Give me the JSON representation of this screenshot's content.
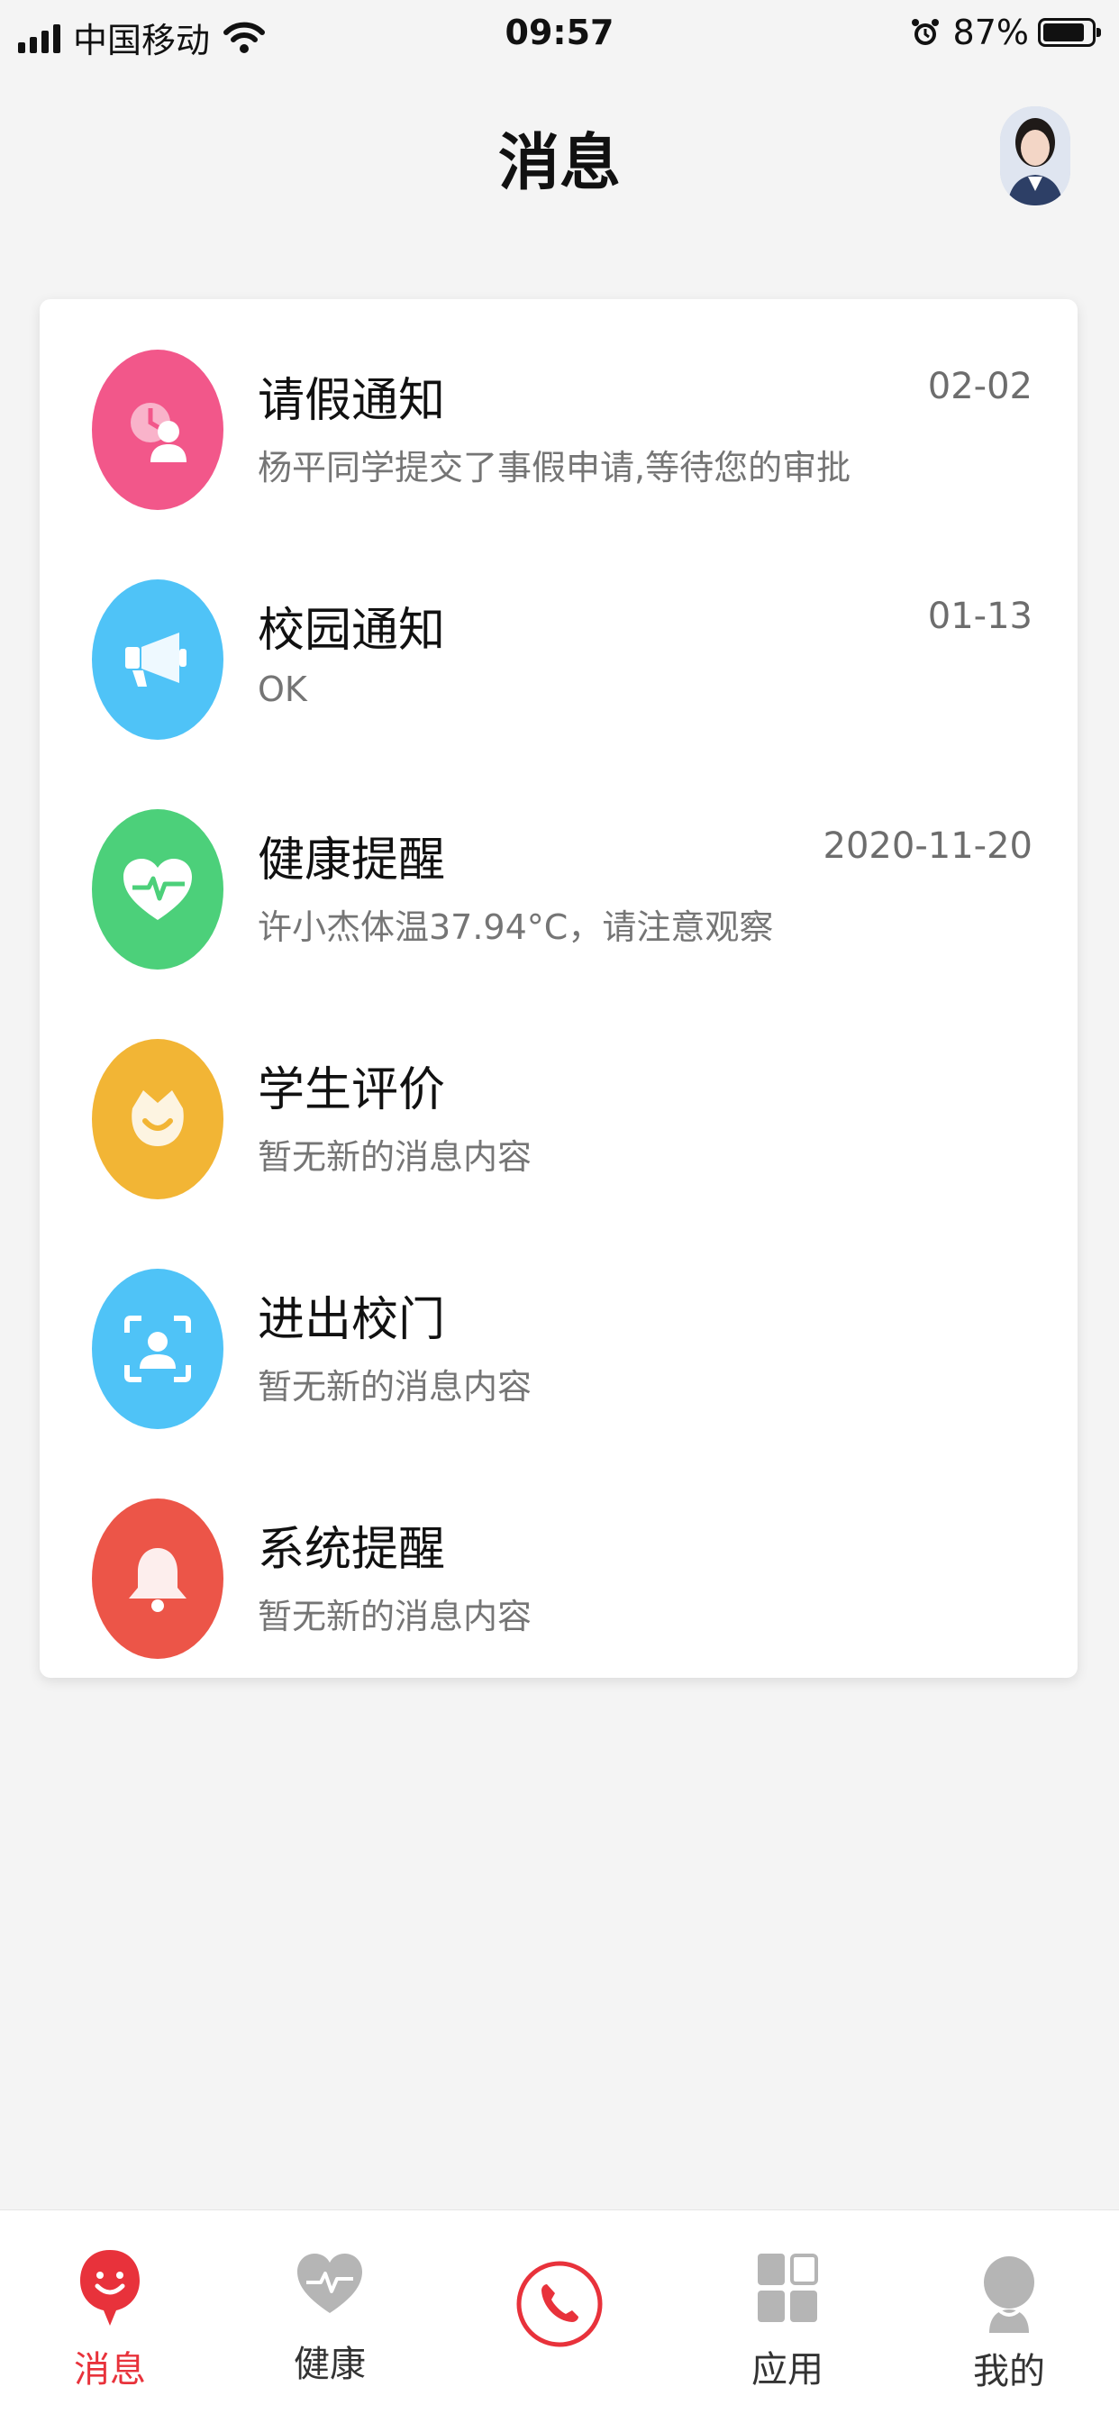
{
  "status_bar": {
    "carrier": "中国移动",
    "time": "09:57",
    "battery": "87%",
    "battery_level": 0.87
  },
  "header": {
    "title": "消息"
  },
  "messages": [
    {
      "title": "请假通知",
      "subtitle": "杨平同学提交了事假申请,等待您的审批",
      "date": "02-02",
      "icon": "leave-icon",
      "color": "#f2578a"
    },
    {
      "title": "校园通知",
      "subtitle": "OK",
      "date": "01-13",
      "icon": "megaphone-icon",
      "color": "#4fc3f7"
    },
    {
      "title": "健康提醒",
      "subtitle": "许小杰体温37.94°C，请注意观察",
      "date": "2020-11-20",
      "icon": "heart-pulse-icon",
      "color": "#4cd07a"
    },
    {
      "title": "学生评价",
      "subtitle": "暂无新的消息内容",
      "date": "",
      "icon": "flower-smile-icon",
      "color": "#f2b535"
    },
    {
      "title": "进出校门",
      "subtitle": "暂无新的消息内容",
      "date": "",
      "icon": "face-scan-icon",
      "color": "#4fc3f7"
    },
    {
      "title": "系统提醒",
      "subtitle": "暂无新的消息内容",
      "date": "",
      "icon": "bell-icon",
      "color": "#ec5548"
    }
  ],
  "tabbar": {
    "items": [
      {
        "label": "消息",
        "icon": "smile-chat-icon",
        "active": true
      },
      {
        "label": "健康",
        "icon": "heart-pulse-icon"
      },
      {
        "label": "",
        "icon": "phone-icon"
      },
      {
        "label": "应用",
        "icon": "apps-icon"
      },
      {
        "label": "我的",
        "icon": "profile-icon"
      }
    ],
    "active_color": "#e8323b",
    "inactive_color": "#b5b5b5"
  }
}
